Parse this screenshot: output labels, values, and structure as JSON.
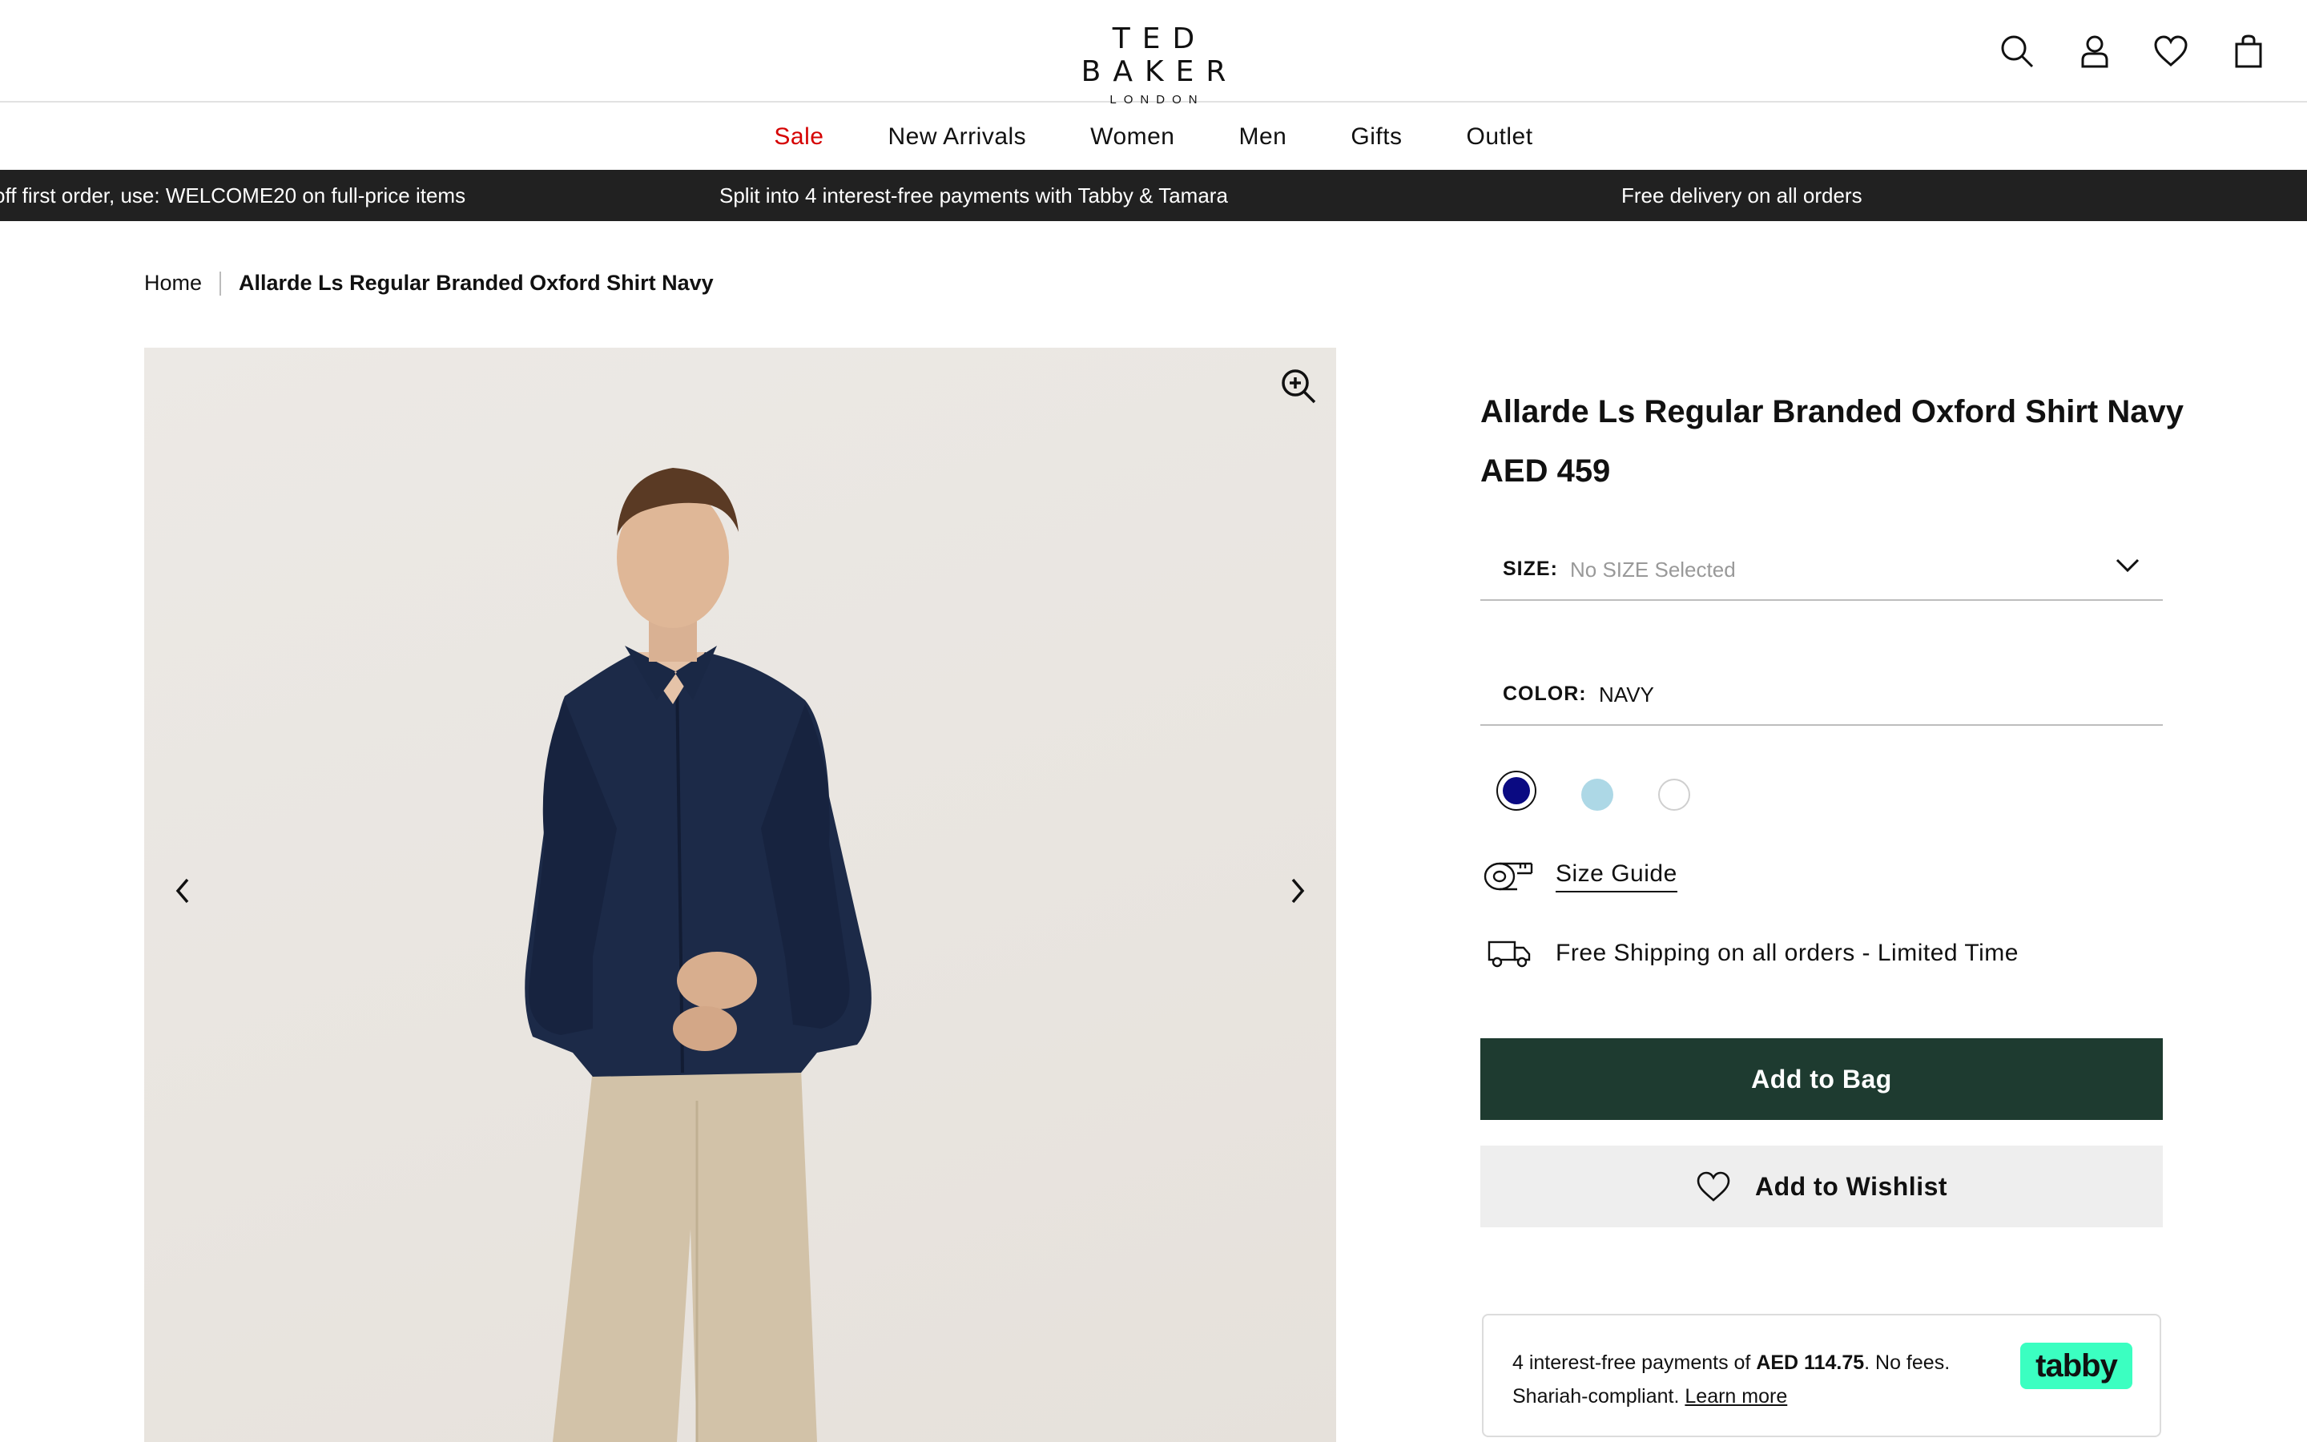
{
  "brand": {
    "name": "TED BAKER",
    "sub": "LONDON"
  },
  "header_icons": [
    "search-icon",
    "account-icon",
    "wishlist-icon",
    "bag-icon"
  ],
  "nav": {
    "items": [
      {
        "label": "Sale",
        "color": "#d50000"
      },
      {
        "label": "New Arrivals"
      },
      {
        "label": "Women"
      },
      {
        "label": "Men"
      },
      {
        "label": "Gifts"
      },
      {
        "label": "Outlet"
      }
    ]
  },
  "promo": {
    "messages": [
      "off first order, use: WELCOME20 on full-price items",
      "Split into 4 interest-free payments with Tabby & Tamara",
      "Free delivery on all orders"
    ],
    "background": "#212121"
  },
  "breadcrumb": {
    "home": "Home",
    "current": "Allarde Ls Regular Branded Oxford Shirt Navy"
  },
  "product": {
    "title": "Allarde Ls Regular Branded Oxford Shirt Navy",
    "price": "AED 459",
    "size": {
      "label": "SIZE:",
      "value": "No SIZE Selected"
    },
    "color": {
      "label": "COLOR:",
      "value": "NAVY"
    },
    "swatches": [
      {
        "name": "navy",
        "hex": "#0a0a82",
        "selected": true
      },
      {
        "name": "light-blue",
        "hex": "#add8e6",
        "selected": false
      },
      {
        "name": "white",
        "hex": "#ffffff",
        "selected": false
      }
    ],
    "size_guide": "Size Guide",
    "shipping": "Free Shipping on all orders - Limited Time",
    "add_to_bag": "Add to Bag",
    "add_to_wishlist": "Add to Wishlist",
    "accent": "#1e3b30"
  },
  "tabby": {
    "line1_pre": "4 interest-free payments of ",
    "amount": "AED 114.75",
    "line1_post": ". No fees.",
    "line2": "Shariah-compliant. ",
    "learn_more": "Learn more",
    "logo": "tabby",
    "logo_color": "#3bffc1"
  }
}
